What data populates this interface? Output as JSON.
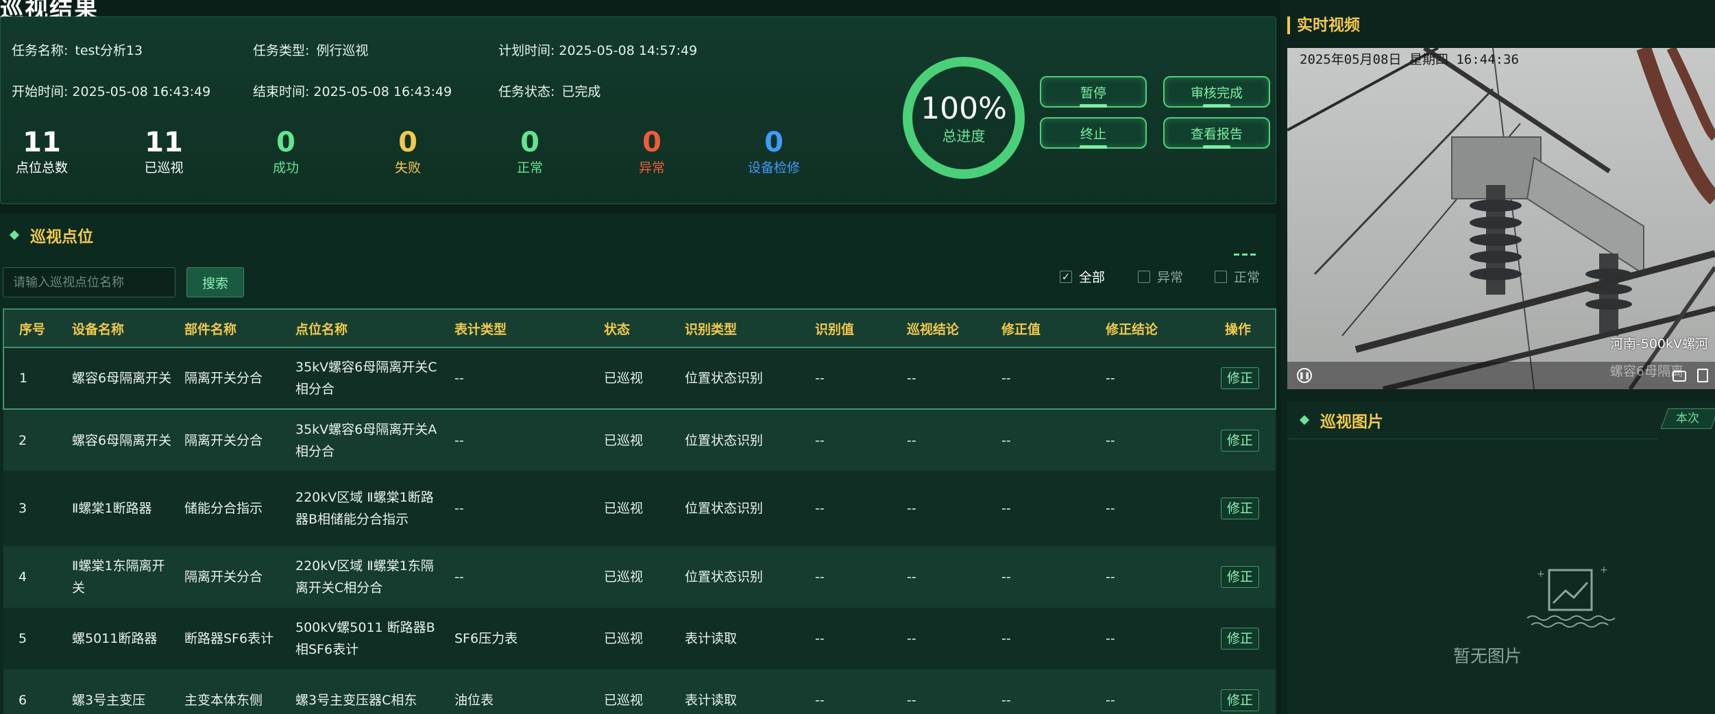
{
  "page": {
    "title": "巡视结果"
  },
  "task": {
    "name_label": "任务名称:",
    "name": "test分析13",
    "type_label": "任务类型:",
    "type": "例行巡视",
    "plan_label": "计划时间:",
    "plan_time": "2025-05-08 14:57:49",
    "start_label": "开始时间:",
    "start_time": "2025-05-08 16:43:49",
    "end_label": "结束时间:",
    "end_time": "2025-05-08 16:43:49",
    "status_label": "任务状态:",
    "status": "已完成"
  },
  "stats": [
    {
      "value": "11",
      "label": "点位总数",
      "color": "#ffffff"
    },
    {
      "value": "11",
      "label": "已巡视",
      "color": "#ffffff"
    },
    {
      "value": "0",
      "label": "成功",
      "color": "#63e48f"
    },
    {
      "value": "0",
      "label": "失败",
      "color": "#f2c94c"
    },
    {
      "value": "0",
      "label": "正常",
      "color": "#63e48f"
    },
    {
      "value": "0",
      "label": "异常",
      "color": "#f15a3a"
    },
    {
      "value": "0",
      "label": "设备检修",
      "color": "#3f9bff"
    }
  ],
  "progress": {
    "percent_text": "100%",
    "label": "总进度",
    "fraction": 1.0
  },
  "controls": {
    "pause": "暂停",
    "audit": "审核完成",
    "stop": "终止",
    "report": "查看报告"
  },
  "points": {
    "title": "巡视点位",
    "search_placeholder": "请输入巡视点位名称",
    "search_button": "搜索",
    "filters": [
      {
        "label": "全部",
        "checked": true
      },
      {
        "label": "异常",
        "checked": false
      },
      {
        "label": "正常",
        "checked": false
      }
    ],
    "columns": [
      "序号",
      "设备名称",
      "部件名称",
      "点位名称",
      "表计类型",
      "状态",
      "识别类型",
      "识别值",
      "巡视结论",
      "修正值",
      "修正结论",
      "操作"
    ],
    "fix_label": "修正",
    "rows": [
      [
        "1",
        "螺容6母隔离开关",
        "隔离开关分合",
        "35kV螺容6母隔离开关C相分合",
        "--",
        "已巡视",
        "位置状态识别",
        "--",
        "--",
        "--",
        "--"
      ],
      [
        "2",
        "螺容6母隔离开关",
        "隔离开关分合",
        "35kV螺容6母隔离开关A相分合",
        "--",
        "已巡视",
        "位置状态识别",
        "--",
        "--",
        "--",
        "--"
      ],
      [
        "3",
        "Ⅱ螺棠1断路器",
        "储能分合指示",
        "220kV区域 Ⅱ螺棠1断路器B相储能分合指示",
        "--",
        "已巡视",
        "位置状态识别",
        "--",
        "--",
        "--",
        "--"
      ],
      [
        "4",
        "Ⅱ螺棠1东隔离开关",
        "隔离开关分合",
        "220kV区域 Ⅱ螺棠1东隔离开关C相分合",
        "--",
        "已巡视",
        "位置状态识别",
        "--",
        "--",
        "--",
        "--"
      ],
      [
        "5",
        "螺5011断路器",
        "断路器SF6表计",
        "500kV螺5011 断路器B相SF6表计",
        "SF6压力表",
        "已巡视",
        "表计读取",
        "--",
        "--",
        "--",
        "--"
      ],
      [
        "6",
        "螺3号主变压",
        "主变本体东侧",
        "螺3号主变压器C相东",
        "油位表",
        "已巡视",
        "表计读取",
        "--",
        "--",
        "--",
        "--"
      ]
    ]
  },
  "video": {
    "title": "实时视频",
    "timestamp": "2025年05月08日 星期四 16:44:36",
    "caption": "河南-500kV螺河",
    "caption2": "螺容6母隔离"
  },
  "photos": {
    "title": "巡视图片",
    "tab": "本次",
    "empty": "暂无图片"
  }
}
